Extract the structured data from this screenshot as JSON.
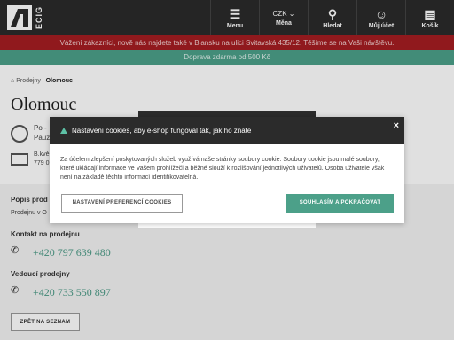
{
  "header": {
    "logo_text": "ECIG",
    "menu_label": "Menu",
    "currency_value": "CZK",
    "currency_label": "Měna",
    "search_label": "Hledat",
    "account_label": "Můj účet",
    "cart_label": "Košík",
    "cart_count": "0"
  },
  "banners": {
    "announcement": "Vážení zákazníci, nově nás najdete také v Blansku na ulici Svitavská 435/12. Těšíme se na Vaši návštěvu.",
    "shipping": "Doprava zdarma od 500 Kč"
  },
  "breadcrumb": {
    "parent": "Prodejny",
    "separator": "|",
    "current": "Olomouc"
  },
  "store": {
    "title": "Olomouc",
    "hours_line1": "Po - ",
    "hours_line2": "Pauz",
    "address_line1": "B.kvě",
    "address_line2": "779 0"
  },
  "sections": {
    "description_title": "Popis prod",
    "description_text": "Prodejnu v O",
    "contact_title": "Kontakt na prodejnu",
    "contact_phone": "+420 797 639 480",
    "manager_title": "Vedoucí prodejny",
    "manager_phone": "+420 733 550 897",
    "back_label": "ZPĚT NA SEZNAM"
  },
  "cookie": {
    "title": "Nastavení cookies, aby e-shop fungoval tak, jak ho znáte",
    "body": "Za účelem zlepšení poskytovaných služeb využívá naše stránky soubory cookie. Soubory cookie jsou malé soubory, které ukládají informace ve Vašem prohlížeči a běžné slouží k rozlišování jednotlivých uživatelů. Osoba uživatele však není na základě těchto informací identifikovatelná.",
    "preferences_label": "NASTAVENÍ PREFERENCÍ COOKIES",
    "accept_label": "SOUHLASÍM A POKRAČOVAT",
    "close_symbol": "×"
  },
  "colors": {
    "header_bg": "#2b2b2b",
    "announcement_bg": "#a41d21",
    "accent_green": "#4ca089"
  }
}
